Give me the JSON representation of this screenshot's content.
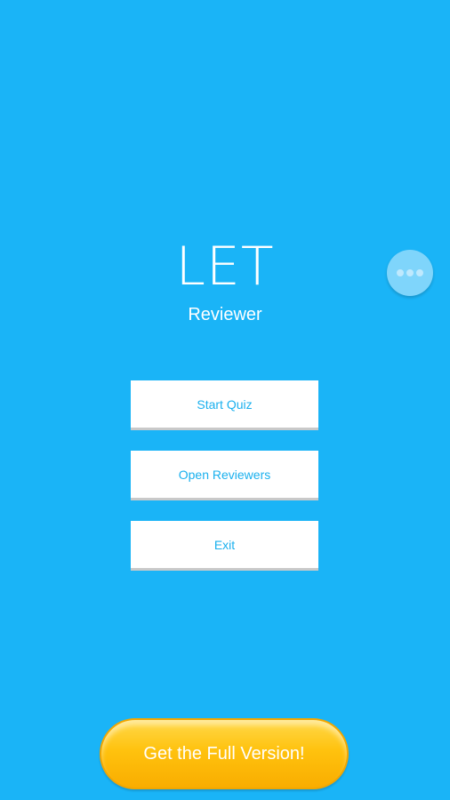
{
  "app": {
    "title": "LET",
    "subtitle": "Reviewer"
  },
  "menu": {
    "start_quiz": "Start Quiz",
    "open_reviewers": "Open Reviewers",
    "exit": "Exit"
  },
  "floating_button": {
    "icon": "more-dots-icon"
  },
  "promo": {
    "label": "Get the Full Version!"
  },
  "colors": {
    "background": "#1ab4f7",
    "button_text": "#1ab0ee",
    "promo": "#ffc20e"
  }
}
